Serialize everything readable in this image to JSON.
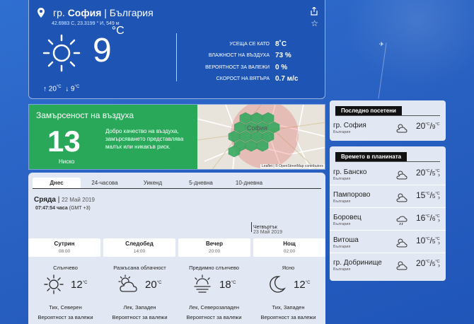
{
  "location": {
    "prefix": "гр.",
    "city": "София",
    "country": "България",
    "coords": "42.6983 С, 23.3199 ° И, 549 м"
  },
  "current": {
    "temp": "9",
    "unit": "°C",
    "high": "20",
    "low": "9",
    "deg_unit": "°C",
    "icon": "sun-icon",
    "stats": [
      {
        "label": "УСЕЩА СЕ КАТО",
        "value": "8˚C"
      },
      {
        "label": "ВЛАЖНОСТ НА ВЪЗДУХА",
        "value": "73 %"
      },
      {
        "label": "ВЕРОЯТНОСТ ЗА ВАЛЕЖИ",
        "value": "0 %"
      },
      {
        "label": "СКОРОСТ НА ВЯТЪРА",
        "value": "0.7 м/с"
      }
    ]
  },
  "air_quality": {
    "title": "Замърсеност на въздуха",
    "index": "13",
    "level": "Ниско",
    "description": "Добро качество на въздуха, замърсяването представлява малък или никакъв риск.",
    "color": "#2aa85a",
    "map_label": "София",
    "map_credit": "Leaflet | © OpenStreetMap contributors"
  },
  "forecast": {
    "tabs": [
      "Днес",
      "24-часова",
      "Уикенд",
      "5-дневна",
      "10-дневна"
    ],
    "day_name": "Сряда",
    "day_date": "22 Май 2019",
    "time": "07:47:54 часа",
    "tz": "(GMT +3)",
    "next_day_name": "Четвъртък",
    "next_day_date": "23 Май 2019",
    "periods": [
      {
        "name": "Сутрин",
        "time": "08:00"
      },
      {
        "name": "Следобед",
        "time": "14:00"
      },
      {
        "name": "Вечер",
        "time": "20:00"
      },
      {
        "name": "Нощ",
        "time": "02:00"
      }
    ],
    "conditions": [
      {
        "name": "Слънчево",
        "temp": "12",
        "unit": "°C",
        "wind": "Тих, Северен",
        "rain": "Вероятност за валежи",
        "icon": "sun-icon"
      },
      {
        "name": "Разкъсана облачност",
        "temp": "20",
        "unit": "°C",
        "wind": "Лек, Западен",
        "rain": "Вероятност за валежи",
        "icon": "partly-cloudy-icon"
      },
      {
        "name": "Предимно слънчево",
        "temp": "18",
        "unit": "°C",
        "wind": "Лек, Северозападен",
        "rain": "Вероятност за валежи",
        "icon": "hazy-sun-icon"
      },
      {
        "name": "Ясно",
        "temp": "12",
        "unit": "°C",
        "wind": "Тих, Западен",
        "rain": "Вероятност за валежи",
        "icon": "moon-icon"
      }
    ]
  },
  "recent": {
    "title": "Последно посетени",
    "items": [
      {
        "city": "гр. София",
        "country": "България",
        "high": "20",
        "low": "9",
        "unit": "°C"
      }
    ]
  },
  "mountains": {
    "title": "Времето в планината",
    "items": [
      {
        "city": "гр. Банско",
        "country": "България",
        "high": "20",
        "low": "5",
        "unit": "°C"
      },
      {
        "city": "Пампорово",
        "country": "България",
        "high": "15",
        "low": "5",
        "unit": "°C"
      },
      {
        "city": "Боровец",
        "country": "България",
        "high": "16",
        "low": "6",
        "unit": "°C"
      },
      {
        "city": "Витоша",
        "country": "България",
        "high": "10",
        "low": "5",
        "unit": "°C"
      },
      {
        "city": "гр. Добринище",
        "country": "България",
        "high": "20",
        "low": "5",
        "unit": "°C"
      }
    ]
  }
}
